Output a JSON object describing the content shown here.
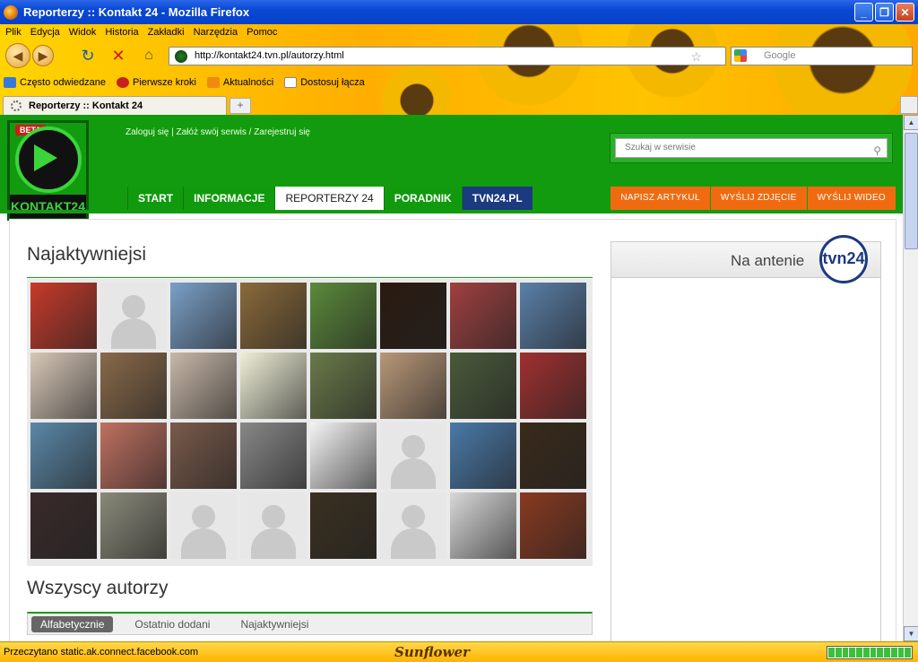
{
  "window": {
    "title": "Reporterzy :: Kontakt 24 - Mozilla Firefox"
  },
  "menu": [
    "Plik",
    "Edycja",
    "Widok",
    "Historia",
    "Zakładki",
    "Narzędzia",
    "Pomoc"
  ],
  "address": {
    "url": "http://kontakt24.tvn.pl/autorzy.html"
  },
  "search": {
    "placeholder": "Google"
  },
  "bookmarks": [
    "Często odwiedzane",
    "Pierwsze kroki",
    "Aktualności",
    "Dostosuj łącza"
  ],
  "tab": {
    "label": "Reporterzy :: Kontakt 24",
    "newtab": "+"
  },
  "site": {
    "logo": {
      "beta": "BETA",
      "name": "KONTAKT24"
    },
    "auth_links": "Zaloguj się | Załóż swój serwis / Zarejestruj się",
    "search_placeholder": "Szukaj w serwisie",
    "nav": [
      "START",
      "INFORMACJE",
      "REPORTERZY 24",
      "PORADNIK",
      "TVN24.PL"
    ],
    "actions": [
      "NAPISZ ARTYKUŁ",
      "WYŚLIJ ZDJĘCIE",
      "WYŚLIJ WIDEO"
    ],
    "most_active_title": "Najaktywniejsi",
    "all_authors_title": "Wszyscy autorzy",
    "filters": [
      "Alfabetycznie",
      "Ostatnio dodani",
      "Najaktywniejsi"
    ],
    "on_air": {
      "label": "Na antenie",
      "logo": "tvn24"
    },
    "avatars": [
      "#c83a2a",
      "ph",
      "#7aa0c8",
      "#8a6a3a",
      "#5a8a3a",
      "#2a1a10",
      "#a04040",
      "#5a80a8",
      "#d8c8b8",
      "#8a6a4a",
      "#c8b8a8",
      "#f0f0d8",
      "#6a7a4a",
      "#b89878",
      "#4a5a3a",
      "#a03030",
      "#5a88a8",
      "#c07060",
      "#7a5a4a",
      "#888888",
      "#f4f4f4",
      "ph",
      "#4a7aa8",
      "#3a2a1a",
      "#3a2a2a",
      "#8a8a7a",
      "ph",
      "ph",
      "#3a3020",
      "ph",
      "#d8d8d8",
      "#8a3a20"
    ]
  },
  "status": {
    "text": "Przeczytano static.ak.connect.facebook.com",
    "brand": "Sunflower"
  }
}
